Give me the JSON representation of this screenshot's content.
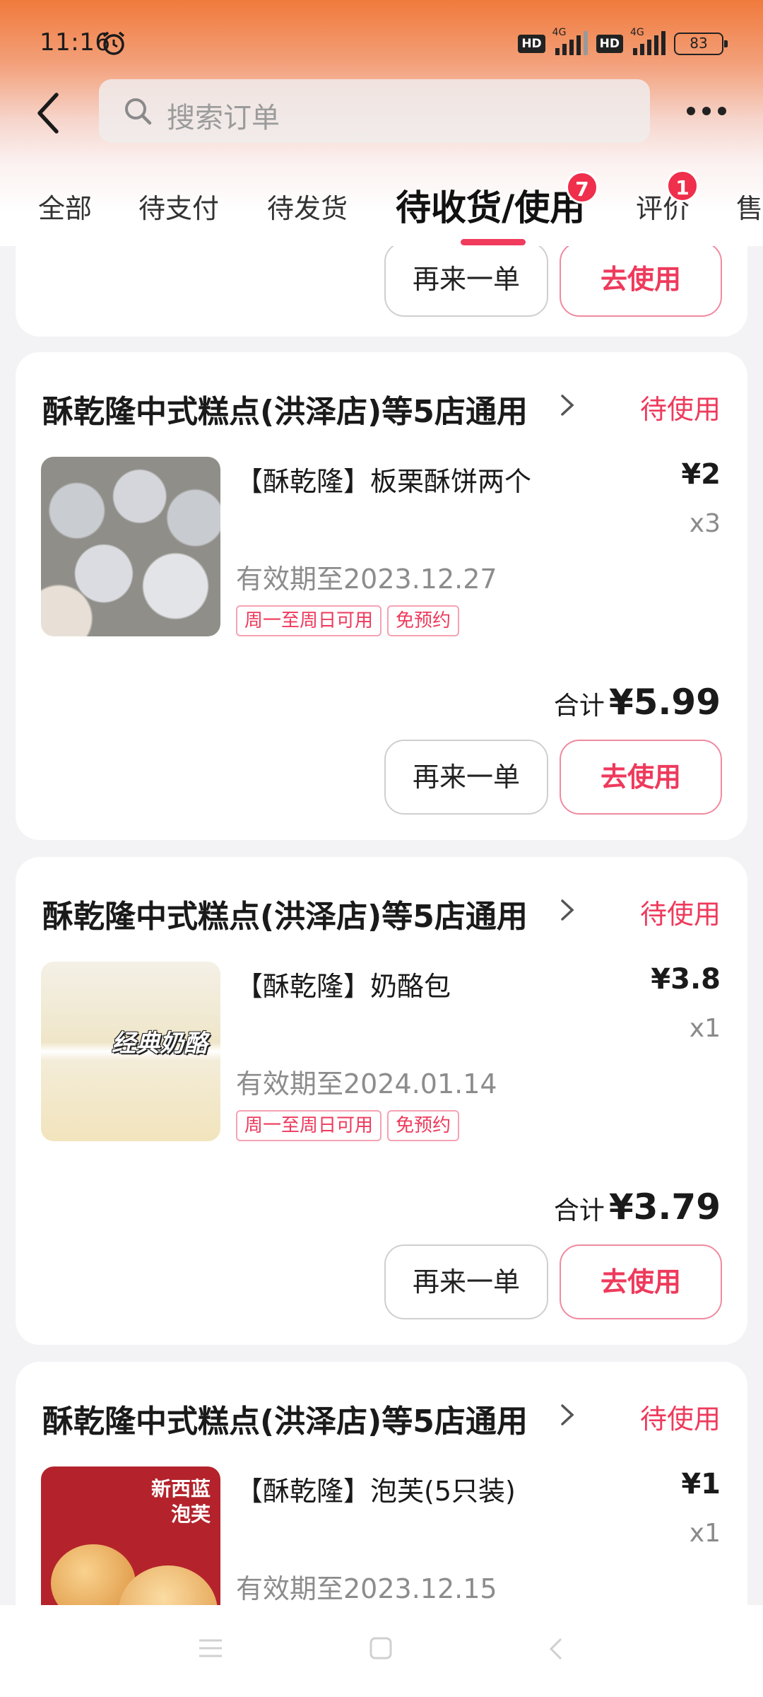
{
  "status_bar": {
    "time": "11:16",
    "hd1": "HD",
    "net1": "4G",
    "hd2": "HD",
    "net2": "4G",
    "battery": "83"
  },
  "search": {
    "placeholder": "搜索订单"
  },
  "tabs": [
    {
      "label": "全部"
    },
    {
      "label": "待支付"
    },
    {
      "label": "待发货"
    },
    {
      "label": "待收货/使用",
      "badge": "7",
      "active": true
    },
    {
      "label": "评价",
      "badge": "1"
    },
    {
      "label": "售"
    }
  ],
  "partial_card": {
    "reorder_label": "再来一单",
    "use_label": "去使用"
  },
  "orders": [
    {
      "store": "酥乾隆中式糕点(洪泽店)等5店通用",
      "status": "待使用",
      "product": "【酥乾隆】板栗酥饼两个",
      "price": "¥2",
      "qty": "x3",
      "valid": "有效期至2023.12.27",
      "tags": [
        "周一至周日可用",
        "免预约"
      ],
      "total_label": "合计",
      "total": "¥5.99",
      "reorder_label": "再来一单",
      "use_label": "去使用"
    },
    {
      "store": "酥乾隆中式糕点(洪泽店)等5店通用",
      "status": "待使用",
      "product": "【酥乾隆】奶酪包",
      "price": "¥3.8",
      "qty": "x1",
      "valid": "有效期至2024.01.14",
      "tags": [
        "周一至周日可用",
        "免预约"
      ],
      "thumb_caption": "经典奶酪",
      "total_label": "合计",
      "total": "¥3.79",
      "reorder_label": "再来一单",
      "use_label": "去使用"
    },
    {
      "store": "酥乾隆中式糕点(洪泽店)等5店通用",
      "status": "待使用",
      "product": "【酥乾隆】泡芙(5只装)",
      "price": "¥1",
      "qty": "x1",
      "valid": "有效期至2023.12.15",
      "thumb_caption_1": "新西蓝",
      "thumb_caption_2": "泡芙"
    }
  ],
  "icons": {
    "back": "chevron-left-icon",
    "search": "search-icon",
    "more": "more-horizontal-icon",
    "alarm": "alarm-icon",
    "store_arrow": "chevron-right-icon"
  },
  "colors": {
    "accent": "#ee3a5c",
    "badge": "#ef2f4b"
  }
}
